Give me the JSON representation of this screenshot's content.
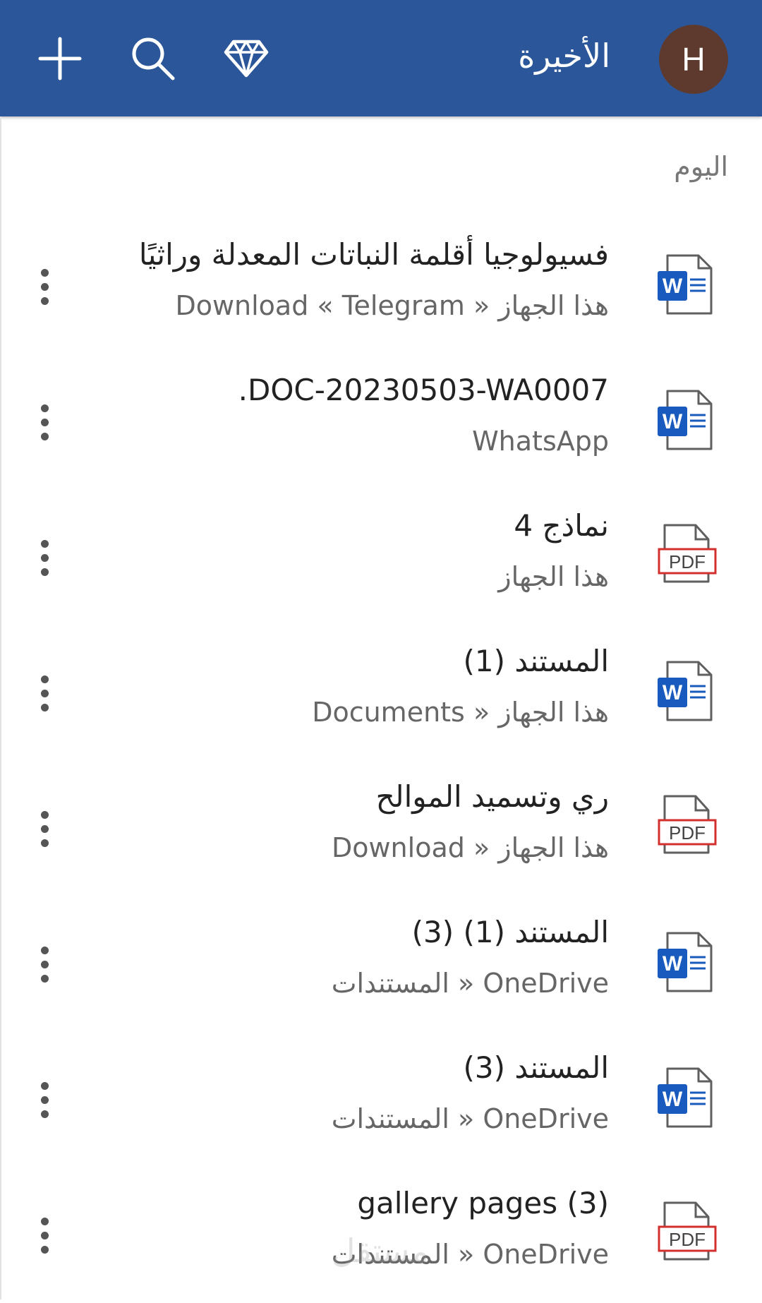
{
  "header": {
    "title": "الأخيرة",
    "avatar_initial": "H",
    "accent_color": "#2b579a",
    "avatar_color": "#5e3a2e",
    "icons": [
      "add-icon",
      "search-icon",
      "premium-diamond-icon"
    ]
  },
  "section": {
    "label": "اليوم"
  },
  "files": [
    {
      "type": "word",
      "title": "فسيولوجيا أقلمة النباتات المعدلة وراثيًا",
      "path": "هذا الجهاز « Download « Telegram"
    },
    {
      "type": "word",
      "title": "DOC-20230503-WA0007.",
      "path": "WhatsApp"
    },
    {
      "type": "pdf",
      "title": "نماذج 4",
      "path": "هذا الجهاز"
    },
    {
      "type": "word",
      "title": "المستند (1)",
      "path": "هذا الجهاز « Documents"
    },
    {
      "type": "pdf",
      "title": "ري وتسميد الموالح",
      "path": "هذا الجهاز « Download"
    },
    {
      "type": "word",
      "title": "المستند (1) (3)",
      "path": "OneDrive « المستندات"
    },
    {
      "type": "word",
      "title": "المستند (3)",
      "path": "OneDrive « المستندات"
    },
    {
      "type": "pdf",
      "title": "gallery pages (3)",
      "path": "OneDrive « المستندات"
    }
  ],
  "icon_labels": {
    "word": "W",
    "pdf": "PDF"
  },
  "colors": {
    "word_blue": "#185abd",
    "pdf_red": "#d32f2f"
  },
  "watermark": "مستقل"
}
